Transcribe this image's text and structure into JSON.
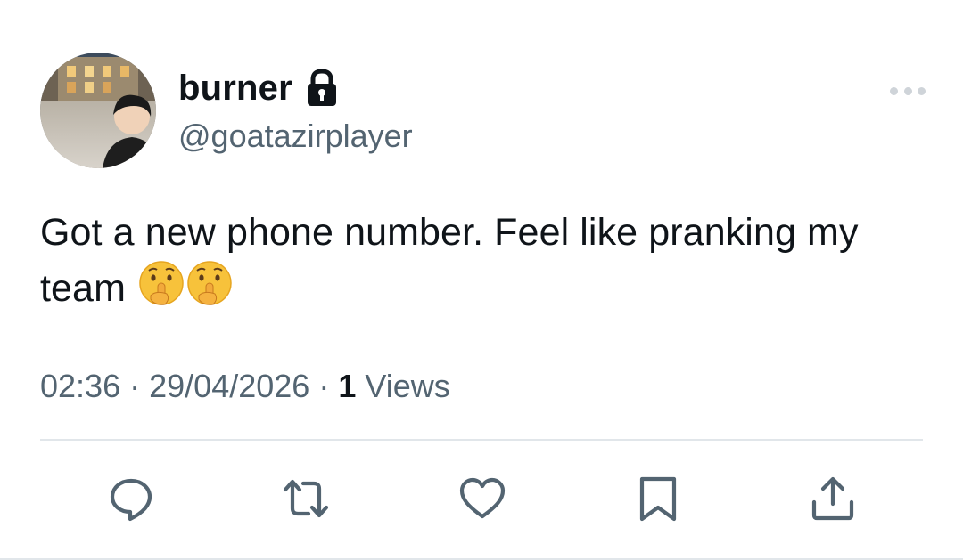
{
  "tweet": {
    "display_name": "burner",
    "handle": "@goatazirplayer",
    "text": "Got a new phone number. Feel like pranking my team",
    "emojis": [
      "shushing-face",
      "shushing-face"
    ],
    "time": "02:36",
    "separator": "·",
    "date": "29/04/2026",
    "views_count": "1",
    "views_label": "Views"
  },
  "icons": {
    "lock": "lock-icon",
    "more": "more-horizontal-icon",
    "reply": "reply-icon",
    "retweet": "retweet-icon",
    "like": "heart-icon",
    "bookmark": "bookmark-icon",
    "share": "share-icon"
  },
  "colors": {
    "text_primary": "#0f1419",
    "text_secondary": "#536471",
    "divider": "#e1e6ea"
  }
}
